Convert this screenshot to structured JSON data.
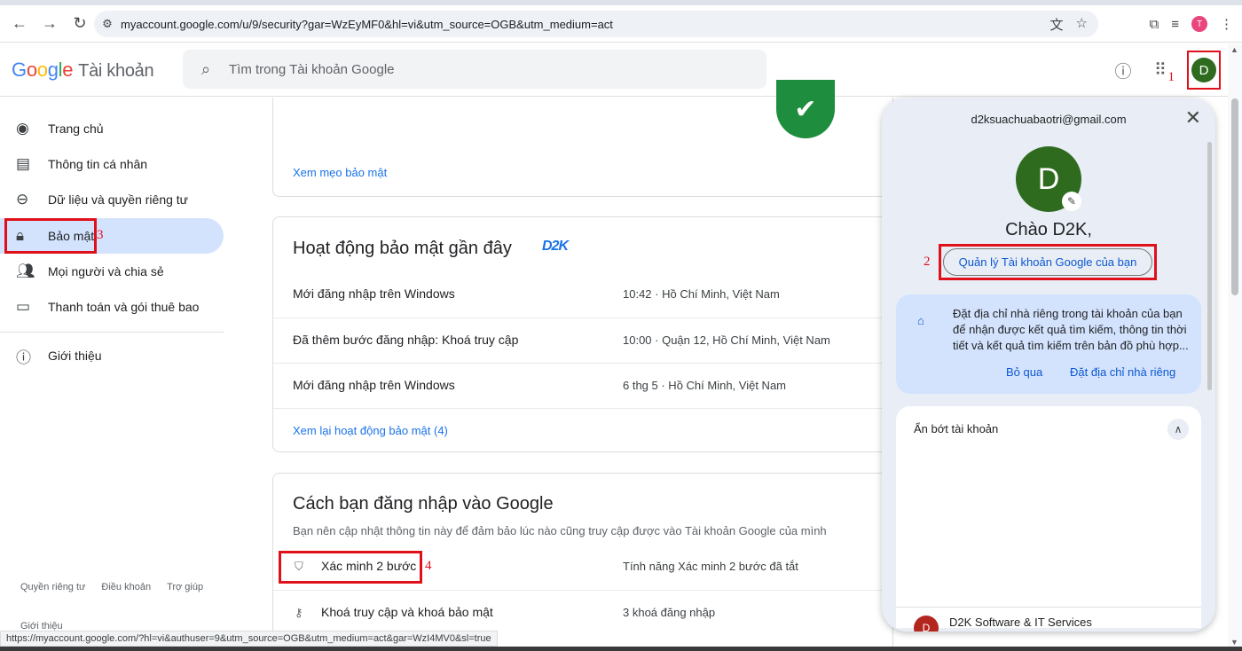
{
  "browser": {
    "url": "myaccount.google.com/u/9/security?gar=WzEyMF0&hl=vi&utm_source=OGB&utm_medium=act",
    "profile_initial": "T",
    "status_url": "https://myaccount.google.com/?hl=vi&authuser=9&utm_source=OGB&utm_medium=act&gar=WzI4MV0&sl=true"
  },
  "header": {
    "logo_letters": [
      "G",
      "o",
      "o",
      "g",
      "l",
      "e"
    ],
    "product": "Tài khoản",
    "search_placeholder": "Tìm trong Tài khoản Google",
    "avatar_initial": "D",
    "marker": "1"
  },
  "sidebar": {
    "items": [
      {
        "label": "Trang chủ",
        "icon": "home-icon"
      },
      {
        "label": "Thông tin cá nhân",
        "icon": "id-card-icon"
      },
      {
        "label": "Dữ liệu và quyền riêng tư",
        "icon": "toggle-icon"
      },
      {
        "label": "Bảo mật",
        "icon": "lock-icon"
      },
      {
        "label": "Mọi người và chia sẻ",
        "icon": "people-icon"
      },
      {
        "label": "Thanh toán và gói thuê bao",
        "icon": "card-icon"
      },
      {
        "label": "Giới thiệu",
        "icon": "info-icon"
      }
    ],
    "marker": "3",
    "footer": [
      "Quyền riêng tư",
      "Điều khoản",
      "Trợ giúp"
    ],
    "footer_about": "Giới thiệu"
  },
  "tips_card": {
    "link": "Xem mẹo bảo mật"
  },
  "activity_card": {
    "title": "Hoạt động bảo mật gần đây",
    "logo_text": "D2K",
    "rows": [
      {
        "label": "Mới đăng nhập trên Windows",
        "value": "10:42 · Hồ Chí Minh, Việt Nam"
      },
      {
        "label": "Đã thêm bước đăng nhập: Khoá truy cập",
        "value": "10:00 · Quận 12, Hồ Chí Minh, Việt Nam"
      },
      {
        "label": "Mới đăng nhập trên Windows",
        "value": "6 thg 5 · Hồ Chí Minh, Việt Nam"
      }
    ],
    "link": "Xem lại hoạt động bảo mật (4)"
  },
  "signin_card": {
    "title": "Cách bạn đăng nhập vào Google",
    "subtitle": "Bạn nên cập nhật thông tin này để đảm bảo lúc nào cũng truy cập được vào Tài khoản Google của mình",
    "rows": [
      {
        "label": "Xác minh 2 bước",
        "value": "Tính năng Xác minh 2 bước đã tắt",
        "icon": "shield-icon"
      },
      {
        "label": "Khoá truy cập và khoá bảo mật",
        "value": "3 khoá đăng nhập",
        "icon": "person-key-icon"
      }
    ],
    "marker": "4"
  },
  "popup": {
    "email": "d2ksuachuabaotri@gmail.com",
    "avatar_initial": "D",
    "greeting": "Chào D2K,",
    "manage_button": "Quản lý Tài khoản Google của bạn",
    "marker": "2",
    "notice": {
      "text": "Đặt địa chỉ nhà riêng trong tài khoản của bạn để nhận được kết quả tìm kiếm, thông tin thời tiết và kết quả tìm kiếm trên bản đồ phù hợp...",
      "skip": "Bỏ qua",
      "set": "Đặt địa chỉ nhà riêng"
    },
    "hide_accounts": "Ẩn bớt tài khoản",
    "account": {
      "initial": "D",
      "name": "D2K Software & IT Services"
    }
  }
}
